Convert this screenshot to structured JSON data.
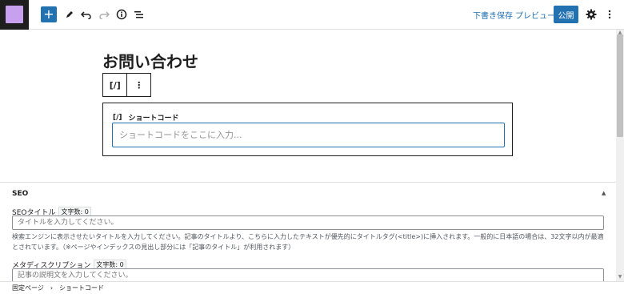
{
  "toolbar": {
    "save_draft": "下書き保存",
    "preview": "プレビュー",
    "publish": "公開",
    "add_icon": "plus-icon",
    "tools_icon": "pencil-icon",
    "undo_icon": "undo-icon",
    "redo_icon": "redo-icon",
    "details_icon": "info-icon",
    "list_view_icon": "list-view-icon",
    "settings_icon": "gear-icon",
    "options_icon": "more-vertical-icon"
  },
  "editor": {
    "title": "お問い合わせ",
    "block_toolbar": {
      "block_icon": "[/]",
      "more": "⋮"
    },
    "shortcode_block": {
      "icon": "[/]",
      "label": "ショートコード",
      "placeholder": "ショートコードをここに入力..."
    }
  },
  "metabox": {
    "heading": "SEO",
    "seo_title": {
      "label": "SEOタイトル",
      "counter": "文字数: 0",
      "placeholder": "タイトルを入力してください。",
      "help": "検索エンジンに表示させたいタイトルを入力してください。記事のタイトルより、こちらに入力したテキストが優先的にタイトルタグ(<title>)に挿入されます。一般的に日本語の場合は、32文字以内が最適とされています。（※ページやインデックスの見出し部分には「記事のタイトル」が利用されます）"
    },
    "meta_description": {
      "label": "メタディスクリプション",
      "counter": "文字数: 0",
      "placeholder": "記事の説明文を入力してください。"
    }
  },
  "footer": {
    "breadcrumb": [
      "固定ページ",
      "ショートコード"
    ],
    "separator": "›"
  },
  "colors": {
    "accent": "#2271b1",
    "site_tile": "#c7a0f0",
    "dark": "#1e1e1e"
  }
}
